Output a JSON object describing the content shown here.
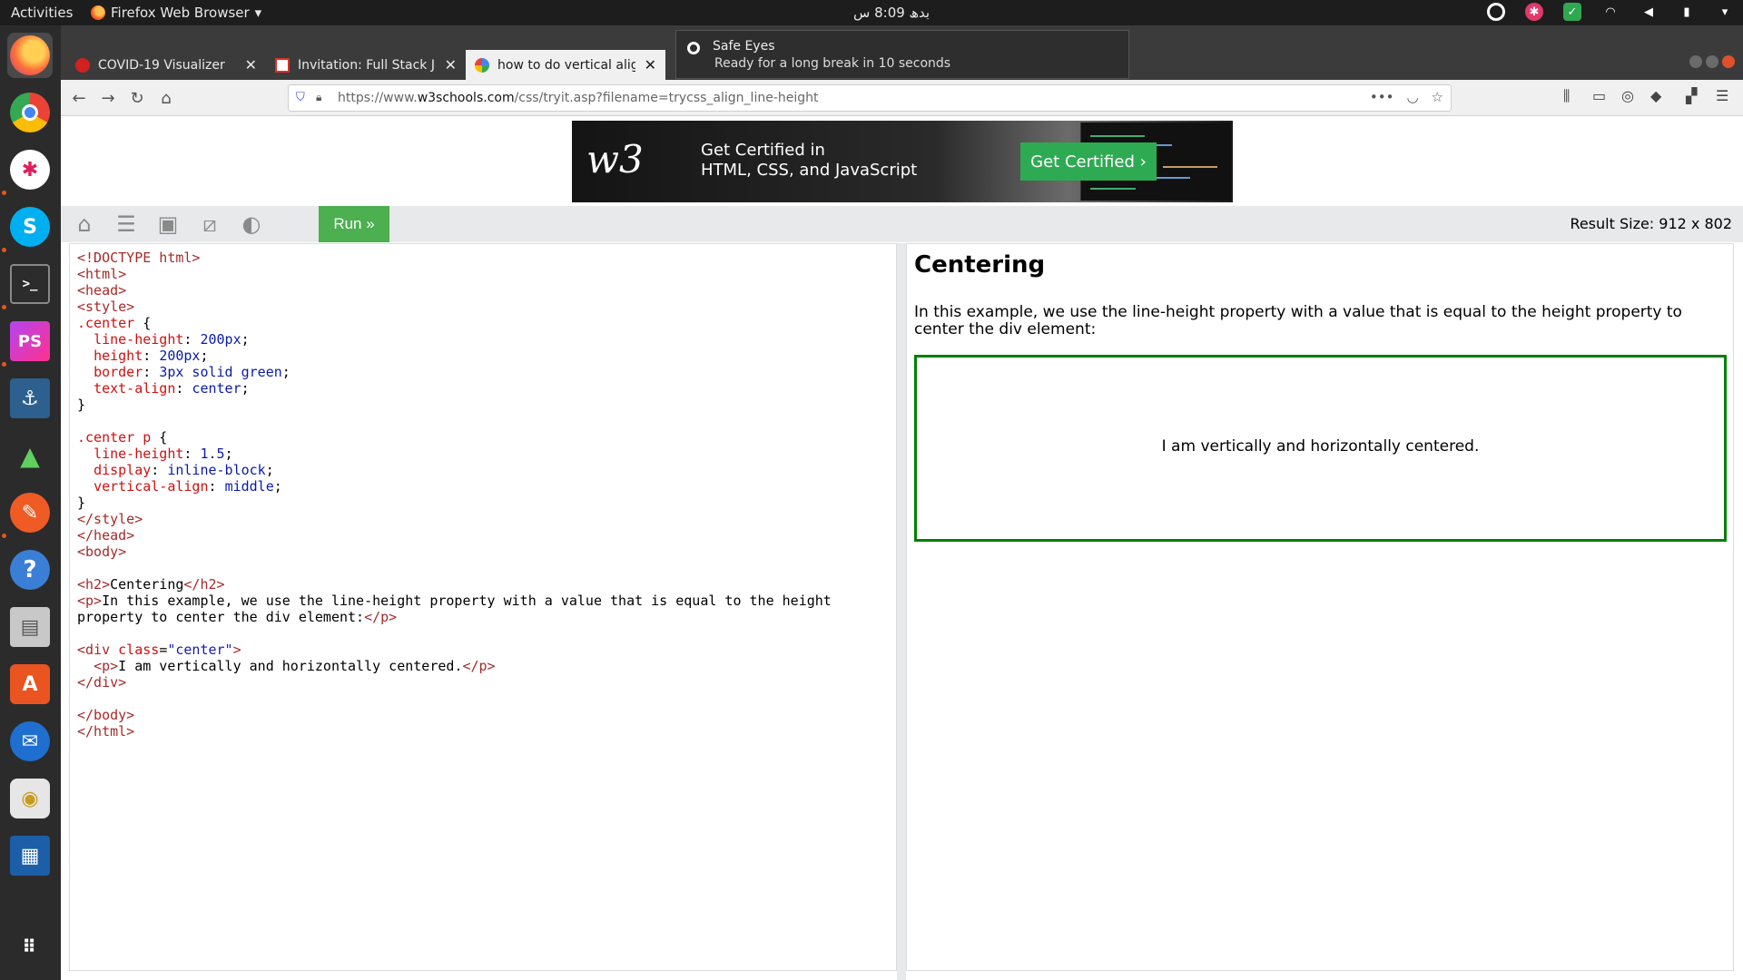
{
  "topbar": {
    "activities": "Activities",
    "app_name": "Firefox Web Browser",
    "clock": "بدھ 8:09 س"
  },
  "dock": {
    "items": [
      "firefox-icon",
      "chrome-icon",
      "slack-icon",
      "skype-icon",
      "terminal-icon",
      "phpstorm-icon",
      "mysql-workbench-icon",
      "rocket-icon",
      "postman-icon",
      "help-icon",
      "files-icon",
      "software-center-icon",
      "thunderbird-icon",
      "rhythmbox-icon",
      "writer-icon",
      "show-apps-icon"
    ],
    "phpstorm_label": "PS",
    "skype_label": "S",
    "help_label": "?",
    "terminal_label": ">_"
  },
  "tabs": [
    {
      "title": "COVID-19 Visualizer",
      "favicon_color": "#d32020"
    },
    {
      "title": "Invitation: Full Stack Java",
      "favicon_color": "#ffffff"
    },
    {
      "title": "how to do vertical align n",
      "favicon_color": "#4285f4"
    }
  ],
  "notification": {
    "title": "Safe Eyes",
    "message": "Ready for a long break in 10 seconds"
  },
  "urlbar": {
    "url_prefix": "https://www.",
    "url_domain": "w3schools.com",
    "url_path": "/css/tryit.asp?filename=trycss_align_line-height"
  },
  "ad": {
    "logo": "w3",
    "line1": "Get Certified in",
    "line2": "HTML, CSS, and JavaScript",
    "cta": "Get Certified ›"
  },
  "toolbar": {
    "run_label": "Run »",
    "result_size_label": "Result Size: 912 x 802"
  },
  "result": {
    "heading": "Centering",
    "paragraph": "In this example, we use the line-height property with a value that is equal to the height property to center the div element:",
    "centered_text": "I am vertically and horizontally centered."
  },
  "colors": {
    "run_green": "#4caf50",
    "border_green": "#008000"
  }
}
